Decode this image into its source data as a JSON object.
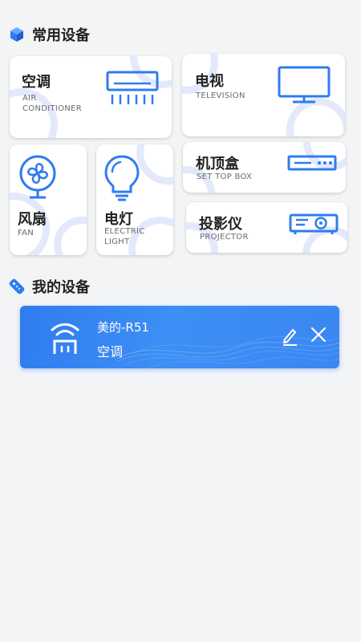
{
  "sections": {
    "common": {
      "title": "常用设备"
    },
    "mine": {
      "title": "我的设备"
    }
  },
  "devices": {
    "air_conditioner": {
      "title": "空调",
      "sub_line1": "AIR",
      "sub_line2": "CONDITIONER"
    },
    "television": {
      "title": "电视",
      "sub": "TELEVISION"
    },
    "fan": {
      "title": "风扇",
      "sub": "FAN"
    },
    "electric_light": {
      "title": "电灯",
      "sub_line1": "ELECTRIC",
      "sub_line2": "LIGHT"
    },
    "set_top_box": {
      "title": "机顶盒",
      "sub": "SET TOP BOX"
    },
    "projector": {
      "title": "投影仪",
      "sub": "PROJECTOR"
    }
  },
  "my_devices": [
    {
      "name": "美的-R51",
      "type": "空调"
    }
  ],
  "colors": {
    "accent": "#2f7cf0",
    "deco": "#e3e9fb",
    "background": "#f3f4f6"
  },
  "icons": {
    "common_header": "cube-icon",
    "mine_header": "remote-control-icon",
    "device_signal": "wifi-signal-icon",
    "edit": "pencil-icon",
    "remove": "close-icon"
  }
}
